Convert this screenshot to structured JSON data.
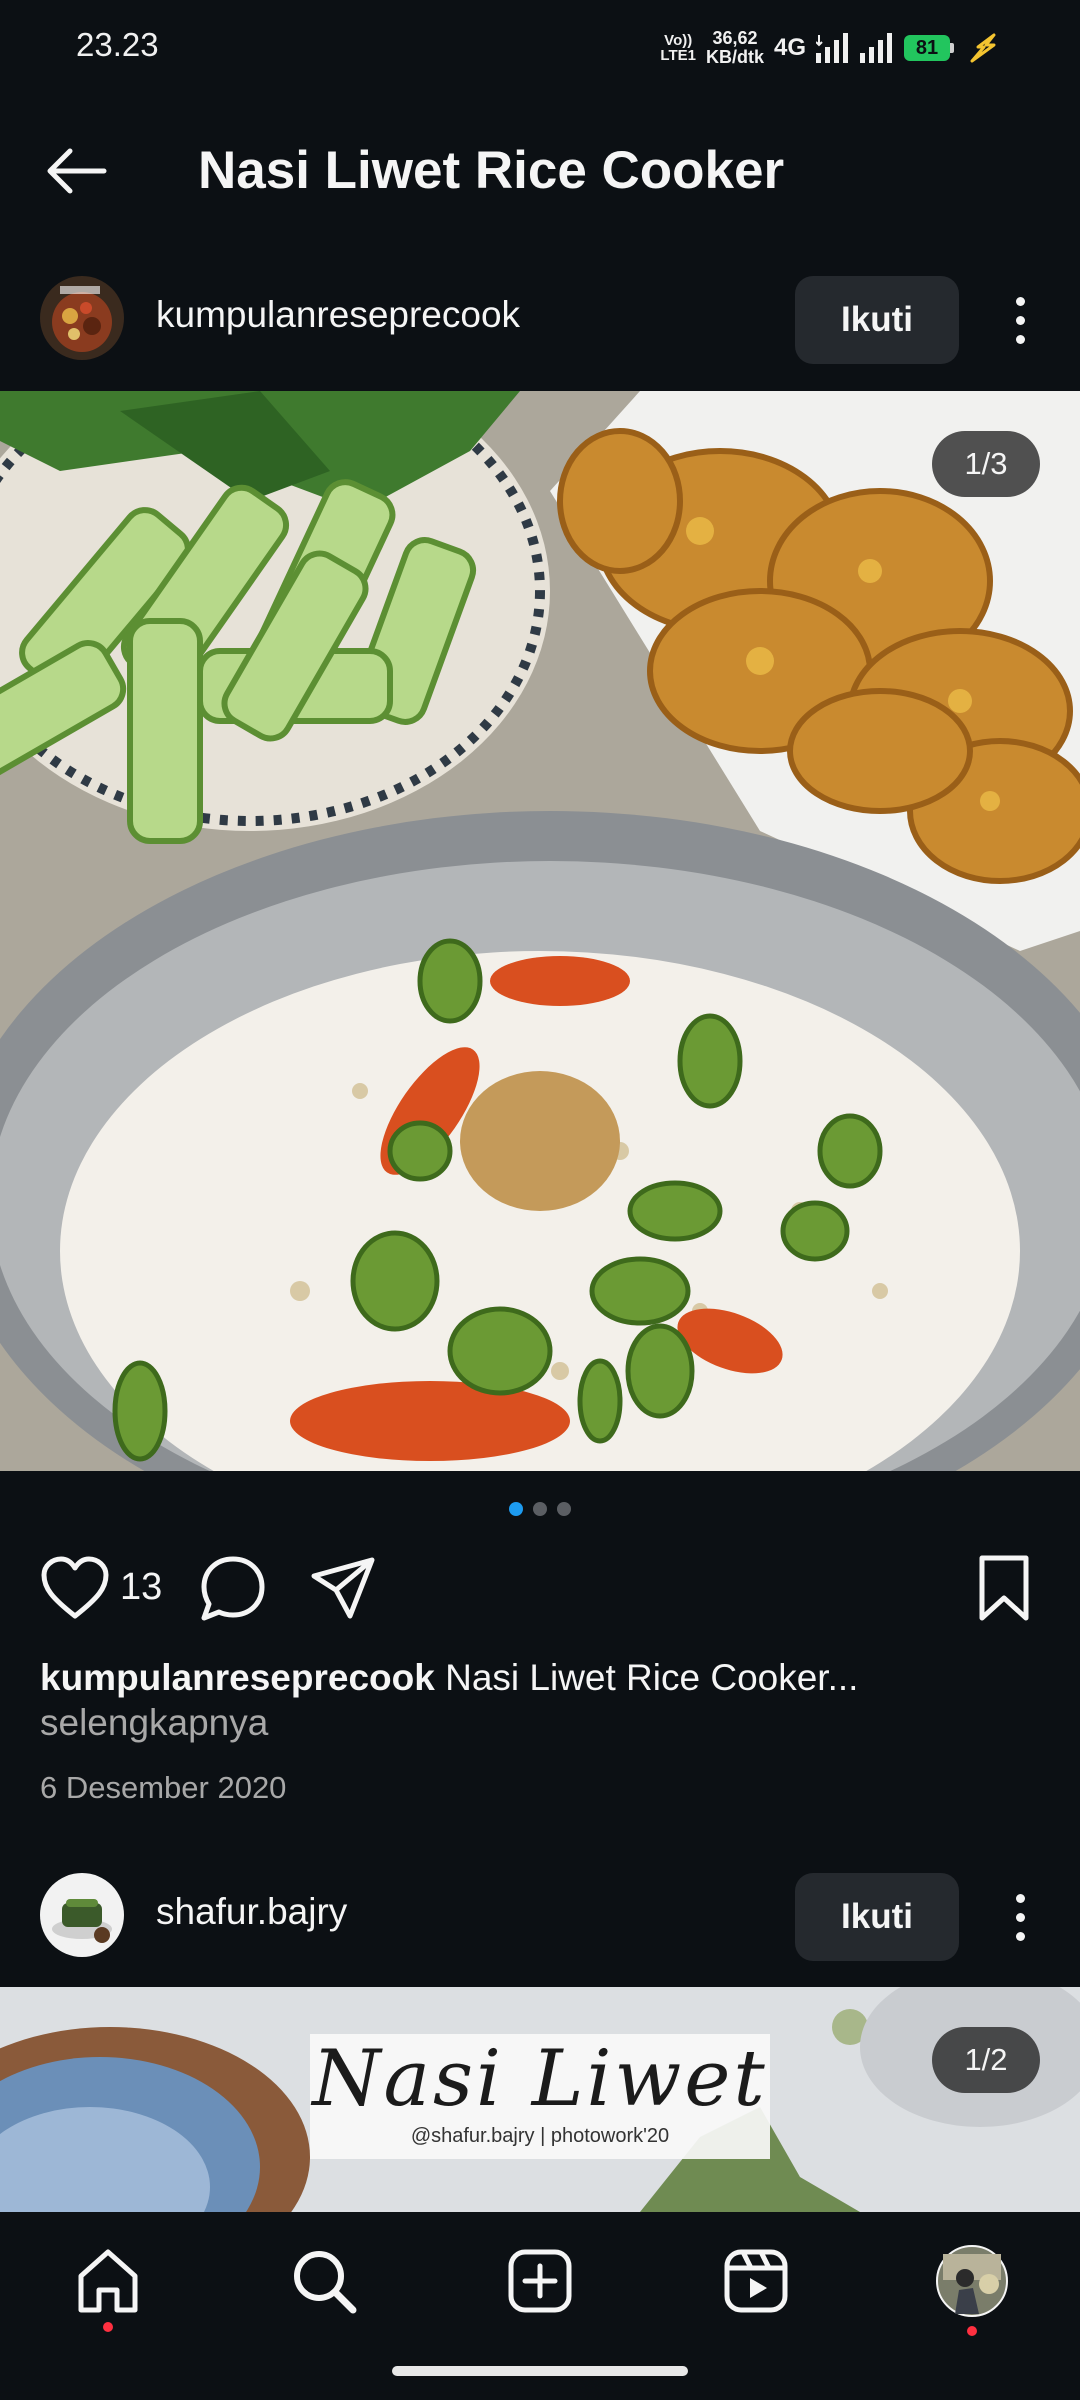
{
  "status": {
    "time": "23.23",
    "volte_top": "Vo))",
    "volte_bottom": "LTE1",
    "speed_value": "36,62",
    "speed_unit": "KB/dtk",
    "network": "4G",
    "battery": "81"
  },
  "header": {
    "title": "Nasi Liwet Rice Cooker",
    "back_icon": "arrow-left-icon"
  },
  "post1": {
    "username": "kumpulanreseprecook",
    "follow_label": "Ikuti",
    "counter": "1/3",
    "likes": "13",
    "caption_user": "kumpulanreseprecook",
    "caption_text": " Nasi Liwet Rice Cooker...",
    "more_label": "selengkapnya",
    "date": "6 Desember 2020",
    "pager": {
      "total": 3,
      "active": 0
    }
  },
  "post2": {
    "username": "shafur.bajry",
    "follow_label": "Ikuti",
    "counter": "1/2",
    "watermark_title": "Nasi Liwet",
    "watermark_sub": "@shafur.bajry | photowork'20"
  },
  "nav": {
    "items": [
      "home-icon",
      "search-icon",
      "create-icon",
      "reels-icon",
      "profile-avatar"
    ]
  },
  "colors": {
    "background": "#0c1014",
    "accent": "#1d9bf0",
    "notification": "#ff3040"
  }
}
